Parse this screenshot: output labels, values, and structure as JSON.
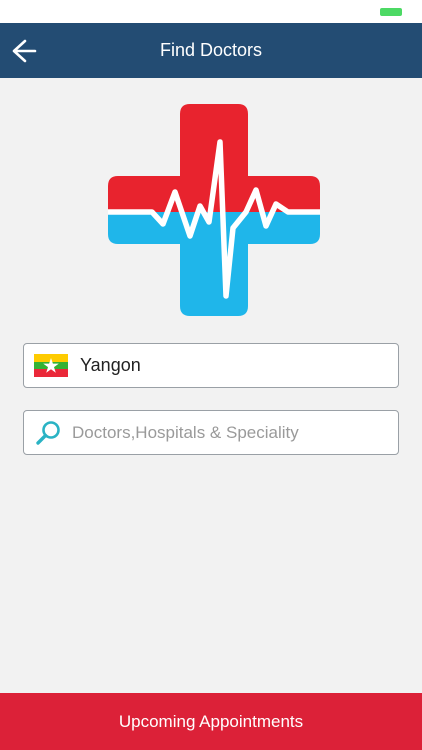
{
  "nav": {
    "title": "Find Doctors",
    "back_icon": "back-arrow-icon"
  },
  "logo": {
    "icon": "medical-cross-heartbeat-logo",
    "colors": {
      "top": "#e8232e",
      "bottom": "#1fb6ea",
      "line": "#ffffff"
    }
  },
  "location": {
    "flag_icon": "myanmar-flag-icon",
    "value": "Yangon"
  },
  "search": {
    "icon": "search-icon",
    "placeholder": "Doctors,Hospitals & Speciality",
    "value": ""
  },
  "footer": {
    "button_label": "Upcoming Appointments"
  },
  "colors": {
    "nav_background": "#234c73",
    "footer_background": "#dc2138",
    "page_background": "#f2f2f2",
    "battery": "#4cd964"
  }
}
